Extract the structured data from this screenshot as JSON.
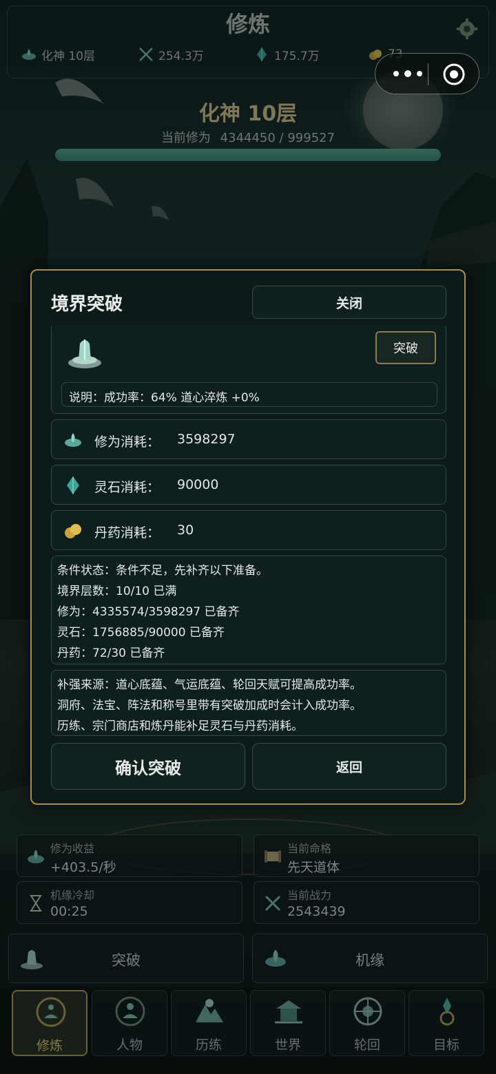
{
  "header": {
    "title": "修炼",
    "stats": [
      {
        "icon": "lotus-icon",
        "value": "化神 10层"
      },
      {
        "icon": "crossed-swords-icon",
        "value": "254.3万"
      },
      {
        "icon": "spirit-stone-icon",
        "value": "175.7万"
      },
      {
        "icon": "pill-gold-icon",
        "value": "73"
      }
    ]
  },
  "realm": {
    "name": "化神 10层",
    "cultivation_label": "当前修为",
    "cultivation_value": "4344450 / 999527",
    "progress_fraction": 1.0
  },
  "modal": {
    "title": "境界突破",
    "close_label": "关闭",
    "break_label": "突破",
    "description": "说明：成功率：64%  道心淬炼 +0%",
    "costs": [
      {
        "icon": "lotus-icon",
        "label": "修为消耗：",
        "value": "3598297"
      },
      {
        "icon": "spirit-stone-icon",
        "label": "灵石消耗：",
        "value": "90000"
      },
      {
        "icon": "pill-gold-icon",
        "label": "丹药消耗：",
        "value": "30"
      }
    ],
    "conditions": [
      "条件状态：条件不足，先补齐以下准备。",
      "境界层数：10/10 已满",
      "修为：4335574/3598297 已备齐",
      "灵石：1756885/90000 已备齐",
      "丹药：72/30 已备齐"
    ],
    "sources": [
      "补强来源：道心底蕴、气运底蕴、轮回天赋可提高成功率。",
      "洞府、法宝、阵法和称号里带有突破加成时会计入成功率。",
      "历练、宗门商店和炼丹能补足灵石与丹药消耗。"
    ],
    "confirm_label": "确认突破",
    "back_label": "返回"
  },
  "info": {
    "income_label": "修为收益",
    "income_value": "+403.5/秒",
    "fate_label": "当前命格",
    "fate_value": "先天道体",
    "cooldown_label": "机缘冷却",
    "cooldown_value": "00:25",
    "power_label": "当前战力",
    "power_value": "2543439"
  },
  "actions": {
    "breakthrough_label": "突破",
    "chance_label": "机缘"
  },
  "nav": [
    {
      "label": "修炼",
      "active": true
    },
    {
      "label": "人物",
      "active": false
    },
    {
      "label": "历练",
      "active": false
    },
    {
      "label": "世界",
      "active": false
    },
    {
      "label": "轮回",
      "active": false
    },
    {
      "label": "目标",
      "active": false
    }
  ],
  "colors": {
    "accent_gold": "#d7c58e",
    "progress_green": "#4a9682",
    "modal_border": "#a88e55",
    "panel_bg": "#0d1a1a"
  }
}
